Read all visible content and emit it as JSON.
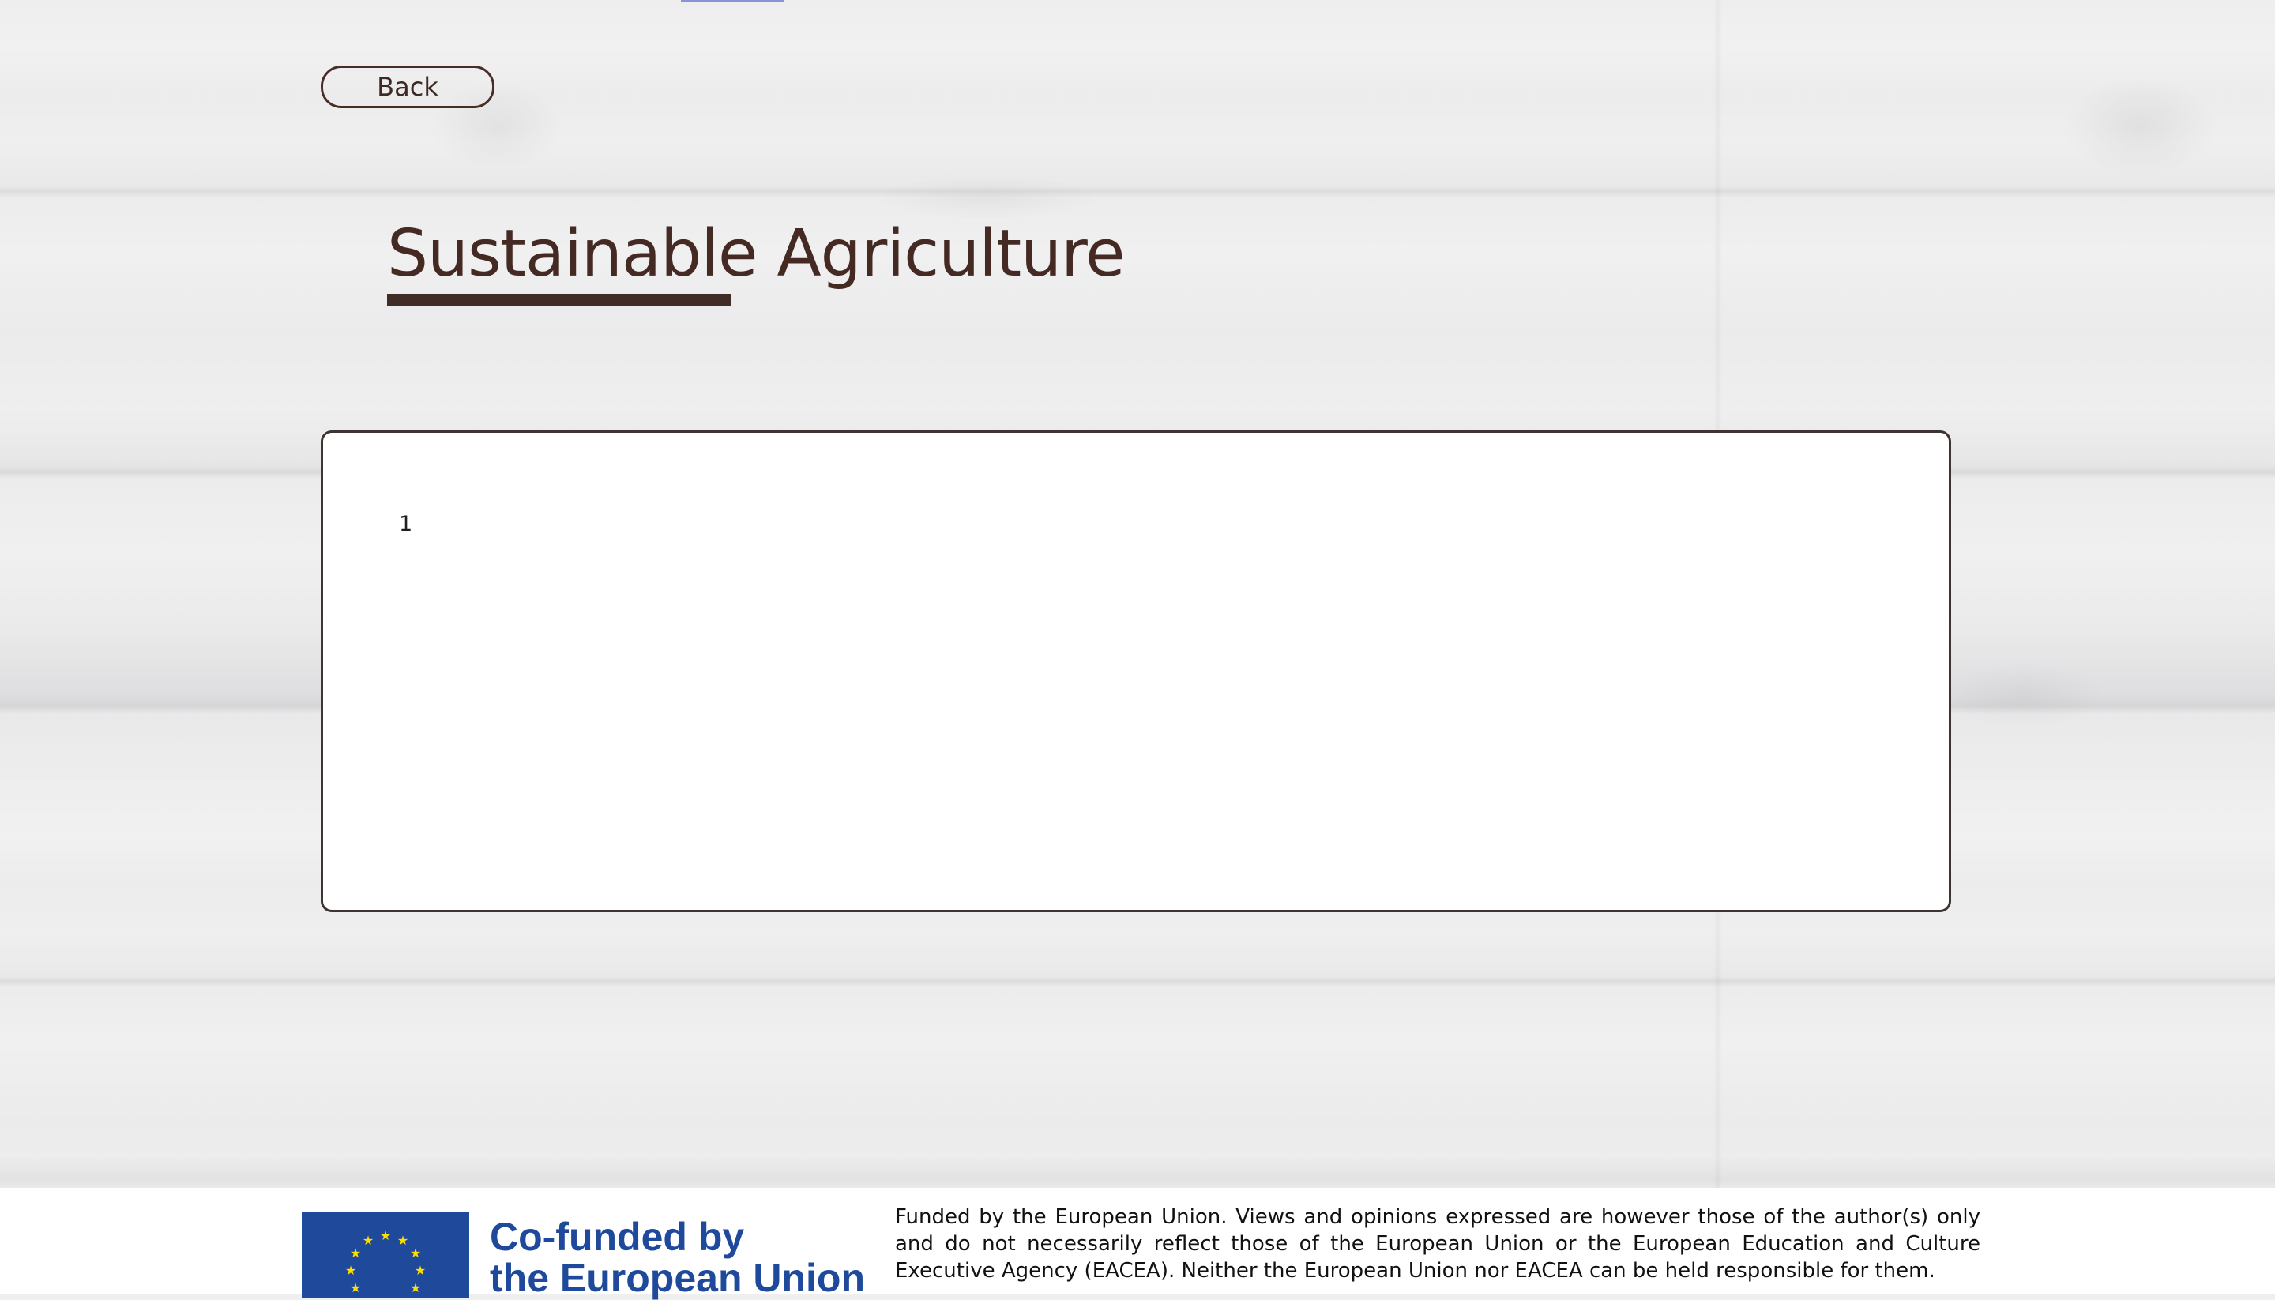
{
  "navigation": {
    "back_label": "Back"
  },
  "header": {
    "title": "Sustainable Agriculture"
  },
  "content": {
    "panel_text": "1"
  },
  "footer": {
    "eu_line1": "Co-funded by",
    "eu_line2": "the European Union",
    "disclaimer": "Funded by the European Union. Views and opinions expressed are however those of the author(s) only and do not necessarily reflect those of the European Union or the European Education and Culture Executive Agency (EACEA). Neither the European Union nor EACEA can be held responsible for them."
  },
  "colors": {
    "accent_brown": "#442a23",
    "eu_blue": "#1f4a9c",
    "eu_star_yellow": "#ffdd00",
    "top_indicator": "#8b93d8"
  },
  "icons": {
    "eu_flag": "eu-flag-icon"
  }
}
